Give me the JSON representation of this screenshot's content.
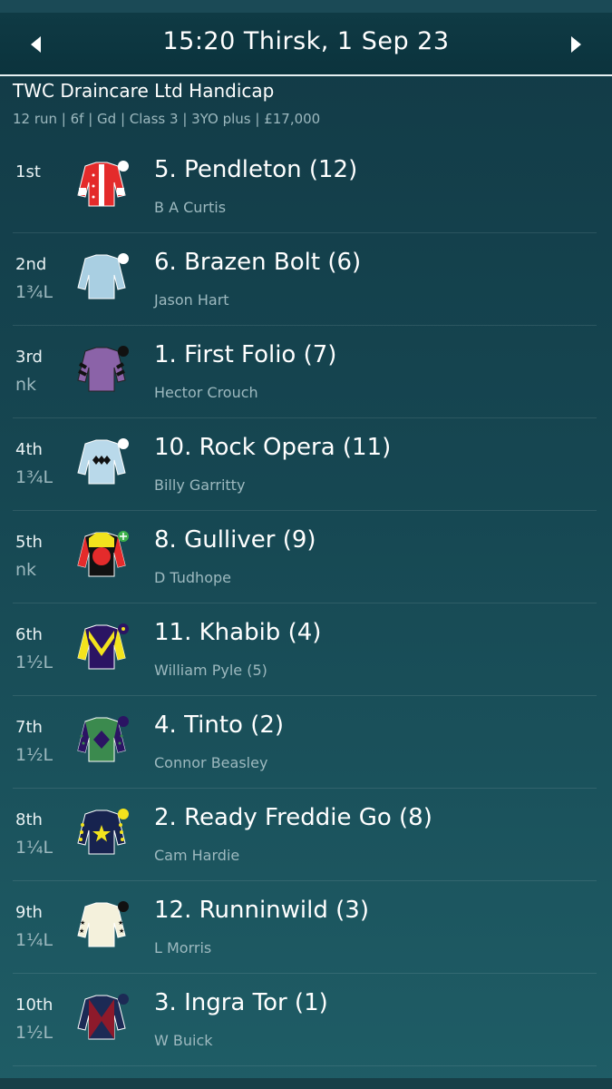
{
  "header": {
    "title": "15:20 Thirsk, 1 Sep 23"
  },
  "race": {
    "name": "TWC Draincare Ltd Handicap",
    "info": "12 run | 6f | Gd | Class 3 | 3YO plus | £17,000"
  },
  "runners": [
    {
      "pos": "1st",
      "dist": "",
      "name": "5. Pendleton (12)",
      "jockey": "B A Curtis",
      "silks_icon": "silks-red-white-stars-icon"
    },
    {
      "pos": "2nd",
      "dist": "1¾L",
      "name": "6. Brazen Bolt (6)",
      "jockey": "Jason Hart",
      "silks_icon": "silks-light-blue-icon"
    },
    {
      "pos": "3rd",
      "dist": "nk",
      "name": "1. First Folio (7)",
      "jockey": "Hector Crouch",
      "silks_icon": "silks-purple-black-chevrons-icon"
    },
    {
      "pos": "4th",
      "dist": "1¾L",
      "name": "10. Rock Opera (11)",
      "jockey": "Billy Garritty",
      "silks_icon": "silks-light-blue-diamonds-icon"
    },
    {
      "pos": "5th",
      "dist": "nk",
      "name": "8. Gulliver (9)",
      "jockey": "D Tudhope",
      "silks_icon": "silks-yellow-red-disc-icon"
    },
    {
      "pos": "6th",
      "dist": "1½L",
      "name": "11. Khabib (4)",
      "jockey": "William Pyle (5)",
      "silks_icon": "silks-navy-yellow-chevron-icon"
    },
    {
      "pos": "7th",
      "dist": "1½L",
      "name": "4. Tinto (2)",
      "jockey": "Connor Beasley",
      "silks_icon": "silks-green-purple-diamond-icon"
    },
    {
      "pos": "8th",
      "dist": "1¼L",
      "name": "2. Ready Freddie Go (8)",
      "jockey": "Cam Hardie",
      "silks_icon": "silks-navy-yellow-star-icon"
    },
    {
      "pos": "9th",
      "dist": "1¼L",
      "name": "12. Runninwild (3)",
      "jockey": "L Morris",
      "silks_icon": "silks-cream-black-stars-icon"
    },
    {
      "pos": "10th",
      "dist": "1½L",
      "name": "3. Ingra Tor (1)",
      "jockey": "W Buick",
      "silks_icon": "silks-navy-maroon-cross-icon"
    }
  ],
  "colors": {
    "background": "#164752",
    "header_bg": "#0b333d",
    "muted_text": "#9db9bf"
  }
}
